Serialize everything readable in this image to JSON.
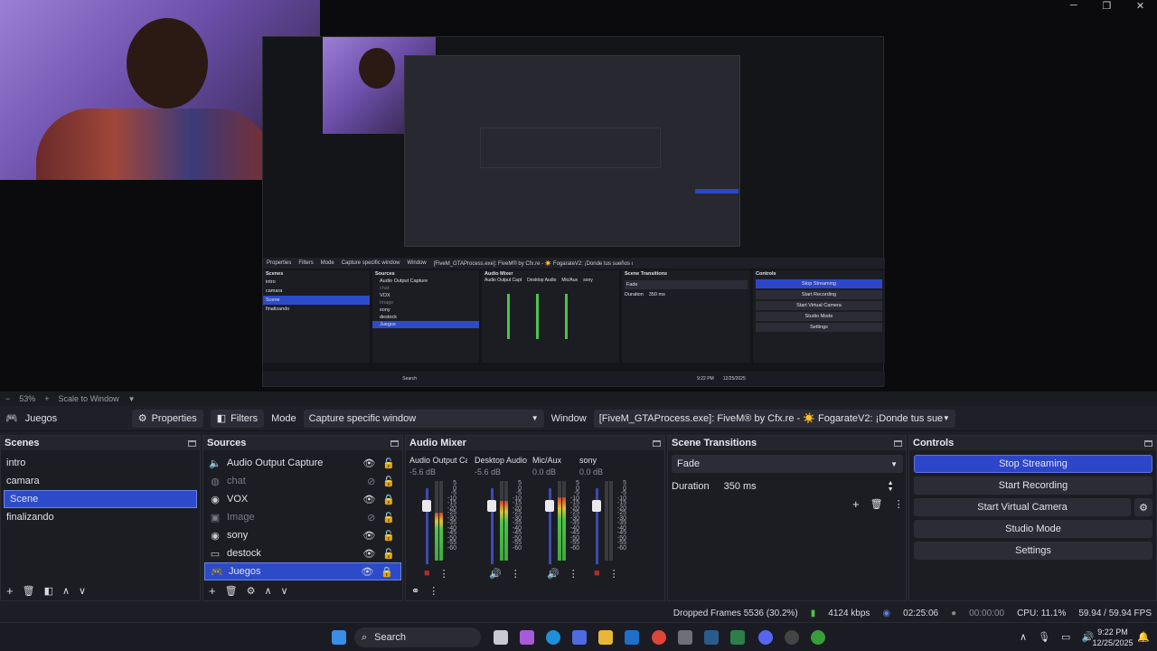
{
  "window": {
    "minimize": "─",
    "maximize": "❐",
    "close": "✕"
  },
  "preview": {
    "zoom_minus": "−",
    "zoom": "53%",
    "zoom_plus": "+",
    "scale_mode": "Scale to Window",
    "nested": {
      "scenes_title": "Scenes",
      "sources_title": "Sources",
      "mixer_title": "Audio Mixer",
      "transitions_title": "Scene Transitions",
      "controls_title": "Controls",
      "properties": "Properties",
      "filters": "Filters",
      "mode_label": "Mode",
      "mode_value": "Capture specific window",
      "window_label": "Window",
      "window_value": "[FiveM_GTAProcess.exe]: FiveM® by Cfx.re - ☀️ FogarateV2: ¡Donde tus sueños cobran vida! ☀️",
      "scenes": [
        "intro",
        "camara",
        "Scene",
        "finalizando"
      ],
      "sources": [
        "Audio Output Capture",
        "chat",
        "VOX",
        "Image",
        "sony",
        "destock",
        "Juegos"
      ],
      "stop_streaming": "Stop Streaming",
      "start_recording": "Start Recording",
      "start_virtual_camera": "Start Virtual Camera",
      "studio_mode": "Studio Mode",
      "settings": "Settings",
      "transition": "Fade",
      "duration_label": "Duration",
      "duration_value": "350 ms",
      "mixer_channels": [
        "Audio Output Capt",
        "Desktop Audio",
        "Mic/Aux",
        "sony"
      ],
      "search": "Search",
      "time": "9:22 PM",
      "date": "12/25/2025"
    }
  },
  "toolbar": {
    "current_source": "Juegos",
    "properties": "Properties",
    "filters": "Filters",
    "mode_label": "Mode",
    "mode_value": "Capture specific window",
    "window_label": "Window",
    "window_value": "[FiveM_GTAProcess.exe]: FiveM® by Cfx.re - ☀️ FogarateV2: ¡Donde tus sueños cobran vida! ☀️"
  },
  "scenes": {
    "title": "Scenes",
    "items": [
      "intro",
      "camara",
      "Scene",
      "finalizando"
    ],
    "selected": "Scene"
  },
  "sources": {
    "title": "Sources",
    "items": [
      {
        "name": "Audio Output Capture",
        "icon": "speaker-icon",
        "visible": true,
        "locked": false,
        "dim": false
      },
      {
        "name": "chat",
        "icon": "browser-icon",
        "visible": false,
        "locked": false,
        "dim": true
      },
      {
        "name": "VOX",
        "icon": "camera-icon",
        "visible": true,
        "locked": true,
        "dim": false
      },
      {
        "name": "Image",
        "icon": "image-icon",
        "visible": false,
        "locked": false,
        "dim": true
      },
      {
        "name": "sony",
        "icon": "camera-icon",
        "visible": true,
        "locked": false,
        "dim": false
      },
      {
        "name": "destock",
        "icon": "monitor-icon",
        "visible": true,
        "locked": false,
        "dim": false
      },
      {
        "name": "Juegos",
        "icon": "gamepad-icon",
        "visible": true,
        "locked": true,
        "dim": false
      }
    ],
    "selected": "Juegos"
  },
  "mixer": {
    "title": "Audio Mixer",
    "channels": [
      {
        "name": "Audio Output Capt",
        "db": "-5.6 dB",
        "level": 0.6,
        "muted": true
      },
      {
        "name": "Desktop Audio",
        "db": "-5.6 dB",
        "level": 0.75,
        "muted": false
      },
      {
        "name": "Mic/Aux",
        "db": "0.0 dB",
        "level": 0.8,
        "muted": false
      },
      {
        "name": "sony",
        "db": "0.0 dB",
        "level": 0.0,
        "muted": true
      }
    ],
    "scale": [
      "5",
      "0",
      "-5",
      "-10",
      "-15",
      "-20",
      "-25",
      "-30",
      "-35",
      "-40",
      "-45",
      "-50",
      "-55",
      "-60"
    ]
  },
  "transitions": {
    "title": "Scene Transitions",
    "type": "Fade",
    "duration_label": "Duration",
    "duration_value": "350 ms"
  },
  "controls": {
    "title": "Controls",
    "stop_streaming": "Stop Streaming",
    "start_recording": "Start Recording",
    "start_virtual_camera": "Start Virtual Camera",
    "studio_mode": "Studio Mode",
    "settings": "Settings"
  },
  "status": {
    "dropped_frames": "Dropped Frames 5536 (30.2%)",
    "bitrate": "4124 kbps",
    "stream_time": "02:25:06",
    "record_time": "00:00:00",
    "cpu": "CPU: 11.1%",
    "fps": "59.94 / 59.94 FPS"
  },
  "taskbar": {
    "search": "Search",
    "time": "9:22 PM",
    "date": "12/25/2025"
  },
  "colors": {
    "accent": "#2d46c9",
    "panel": "#1c1d23",
    "background": "#1e1f26"
  }
}
